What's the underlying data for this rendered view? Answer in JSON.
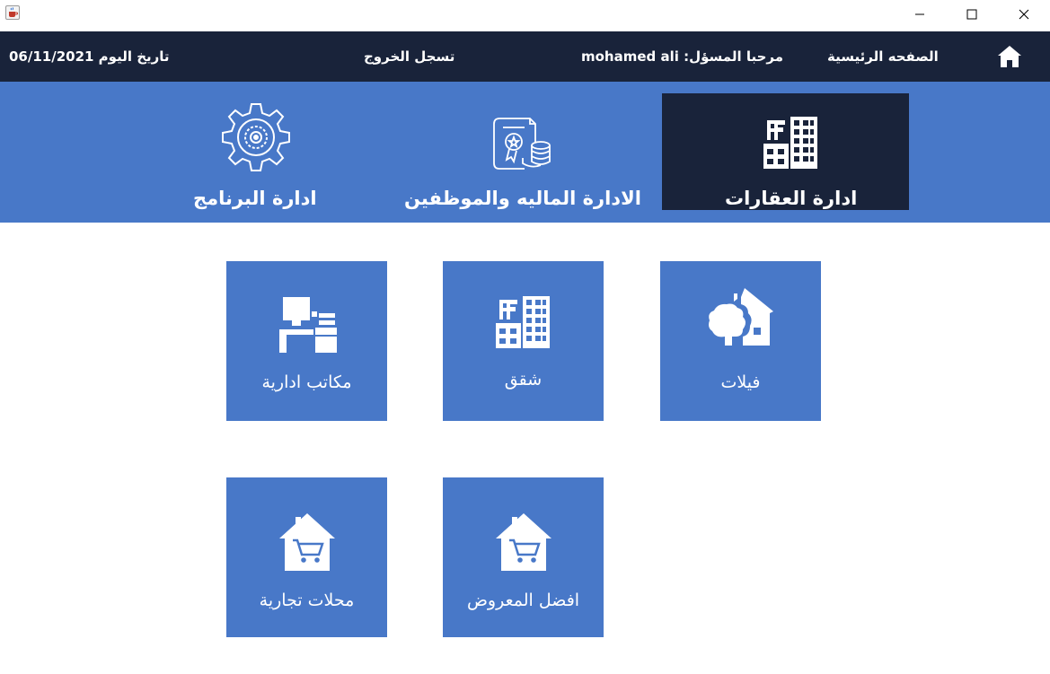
{
  "window": {
    "icon": "java-cup-icon",
    "controls": [
      "minimize-icon",
      "maximize-icon",
      "close-icon"
    ]
  },
  "topbar": {
    "date_label": "تاريخ اليوم 06/11/2021",
    "logout_label": "تسجل الخروج",
    "welcome_label": "مرحبا المسؤل: mohamed ali",
    "home_label": "الصفحه الرئيسية",
    "home_icon": "home-icon"
  },
  "banner": {
    "items": [
      {
        "label": "ادارة البرنامج",
        "icon": "gear-icon"
      },
      {
        "label": "الادارة الماليه والموظفين",
        "icon": "certificate-coins-icon"
      },
      {
        "label": "ادارة العقارات",
        "icon": "buildings-icon",
        "active": true
      }
    ]
  },
  "tiles": [
    {
      "label": "مكاتب ادارية",
      "icon": "office-desk-icon"
    },
    {
      "label": "شقق",
      "icon": "buildings-icon"
    },
    {
      "label": "فيلات",
      "icon": "villa-tree-icon"
    },
    {
      "label": "محلات تجارية",
      "icon": "shop-cart-icon"
    },
    {
      "label": "افضل المعروض",
      "icon": "shop-cart-icon"
    }
  ],
  "colors": {
    "dark": "#19233a",
    "accent": "#4878c8",
    "text_light": "#ffffff"
  }
}
